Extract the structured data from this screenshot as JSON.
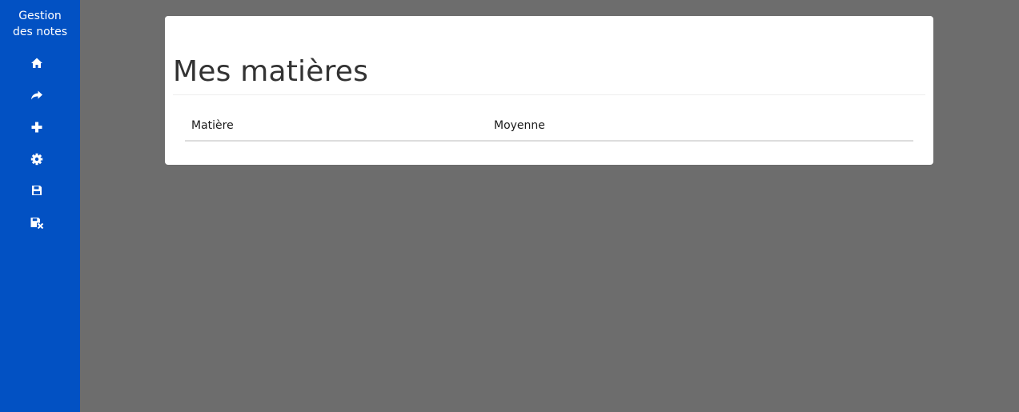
{
  "app": {
    "brand_line1": "Gestion",
    "brand_line2": "des notes"
  },
  "sidebar": {
    "background": "#0251c3",
    "items": [
      {
        "icon": "home-icon"
      },
      {
        "icon": "share-icon"
      },
      {
        "icon": "plus-icon"
      },
      {
        "icon": "gear-icon"
      },
      {
        "icon": "save-icon"
      },
      {
        "icon": "save-remove-icon"
      }
    ]
  },
  "main": {
    "title": "Mes matières",
    "table": {
      "columns": [
        "Matière",
        "Moyenne"
      ],
      "rows": []
    }
  },
  "colors": {
    "page_background": "#6d6d6d",
    "card_background": "#ffffff"
  }
}
